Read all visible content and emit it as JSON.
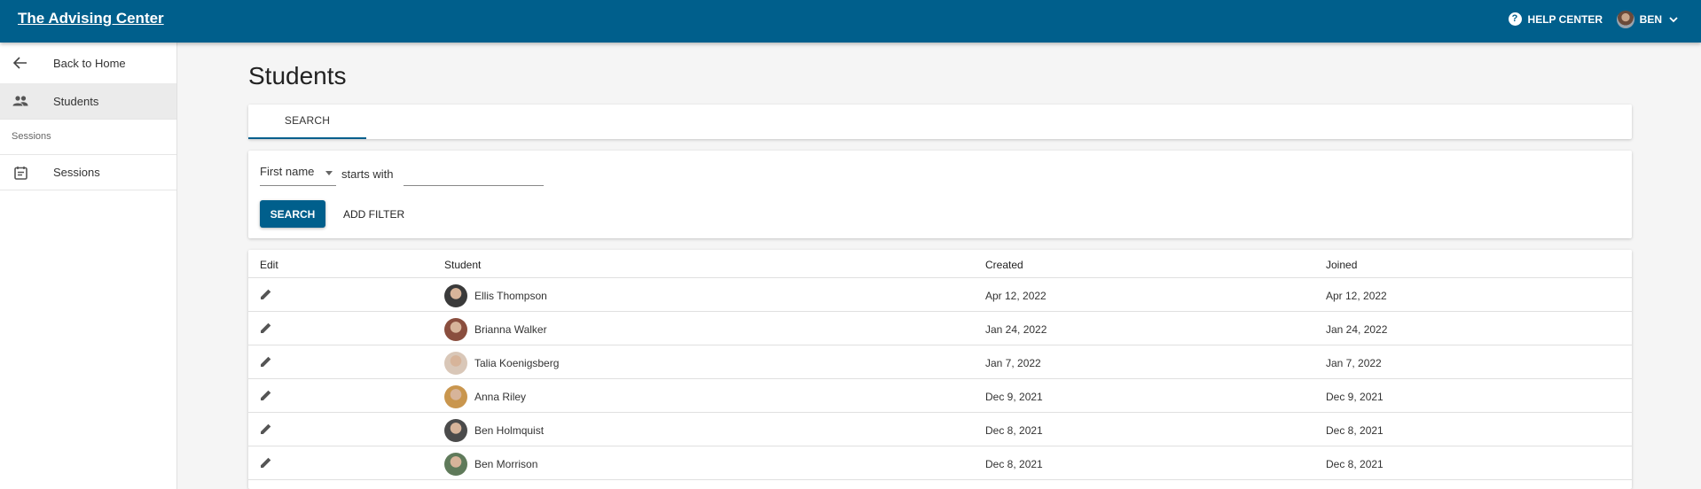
{
  "header": {
    "brand": "The Advising Center",
    "help_label": "HELP CENTER",
    "user_label": "BEN"
  },
  "sidebar": {
    "back_label": "Back to Home",
    "students_label": "Students",
    "section_label": "Sessions",
    "sessions_label": "Sessions"
  },
  "page": {
    "title": "Students"
  },
  "tabs": [
    {
      "label": "SEARCH"
    }
  ],
  "filter": {
    "field_value": "First name",
    "operator": "starts with",
    "input_value": "",
    "input_placeholder": "",
    "search_label": "SEARCH",
    "add_filter_label": "ADD FILTER"
  },
  "table": {
    "columns": {
      "edit": "Edit",
      "student": "Student",
      "created": "Created",
      "joined": "Joined"
    },
    "rows": [
      {
        "student": "Ellis Thompson",
        "created": "Apr 12, 2022",
        "joined": "Apr 12, 2022",
        "avatar_color": "#3a3a3a"
      },
      {
        "student": "Brianna Walker",
        "created": "Jan 24, 2022",
        "joined": "Jan 24, 2022",
        "avatar_color": "#8a4e3e"
      },
      {
        "student": "Talia Koenigsberg",
        "created": "Jan 7, 2022",
        "joined": "Jan 7, 2022",
        "avatar_color": "#d9c7b8"
      },
      {
        "student": "Anna Riley",
        "created": "Dec 9, 2021",
        "joined": "Dec 9, 2021",
        "avatar_color": "#c9964e"
      },
      {
        "student": "Ben Holmquist",
        "created": "Dec 8, 2021",
        "joined": "Dec 8, 2021",
        "avatar_color": "#4b4b4b"
      },
      {
        "student": "Ben Morrison",
        "created": "Dec 8, 2021",
        "joined": "Dec 8, 2021",
        "avatar_color": "#5f7a5a"
      }
    ]
  },
  "colors": {
    "primary": "#005f8c",
    "background": "#f5f5f5"
  }
}
